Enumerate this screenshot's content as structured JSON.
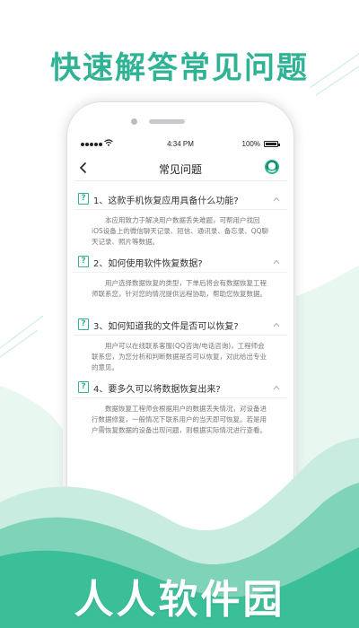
{
  "promo": {
    "headline": "快速解答常见问题",
    "watermark": "人人软件园"
  },
  "status_bar": {
    "time": "4:34 PM",
    "battery": "100%"
  },
  "nav": {
    "title": "常见问题",
    "back_icon": "chevron-left-icon",
    "support_icon": "customer-service-icon"
  },
  "faq": {
    "items": [
      {
        "badge": "?",
        "question": "1、这款手机恢复应用具备什么功能?",
        "answer": "本应用致力于解决用户数据丢失难题，可帮用户找回iOS设备上的微信聊天记录、短信、通讯录、备忘录、QQ聊天记录、照片等数据。"
      },
      {
        "badge": "?",
        "question": "2、如何使用软件恢复数据?",
        "answer": "用户选择数据恢复的类型，下单后将会有数据恢复工程师联系您，针对您的情况提供远程协助，帮助您恢复数据。"
      },
      {
        "badge": "?",
        "question": "3、如何知道我的文件是否可以恢复?",
        "answer": "用户可以在线联系客服(QQ咨询/电话咨询)，工程师会联系您，为您分析和判断数据是否可以恢复，对此给出专业的意见。"
      },
      {
        "badge": "?",
        "question": "4、要多久可以将数据恢复出来?",
        "answer": "数据恢复工程师会根据用户的数据丢失情况，对设备进行数据修复，一般情况下联系用户的当天即可恢复。若是用户需恢复数据的设备出现问题，则根据实际情况进行查看。"
      }
    ]
  },
  "colors": {
    "accent": "#2fb394",
    "wave_light": "#c8ecdf",
    "wave_mid": "#7fd3b8",
    "wave_dark": "#3bbf99"
  }
}
